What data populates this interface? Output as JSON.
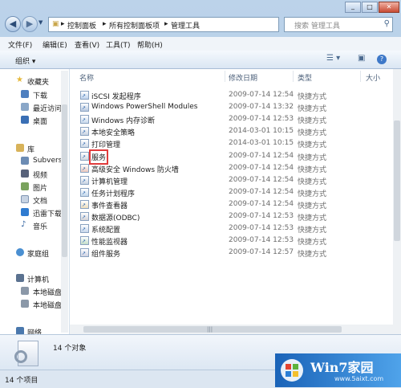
{
  "address": {
    "breadcrumbs": [
      "控制面板",
      "所有控制面板项",
      "管理工具"
    ],
    "search_placeholder": "搜索 管理工具"
  },
  "menubar": [
    "文件(F)",
    "编辑(E)",
    "查看(V)",
    "工具(T)",
    "帮助(H)"
  ],
  "toolbar": {
    "organize_label": "组织 ▾"
  },
  "nav": {
    "favorites": {
      "label": "收藏夹",
      "items": [
        "下载",
        "最近访问",
        "桌面"
      ]
    },
    "libraries": {
      "label": "库",
      "items": [
        "Subvers",
        "视频",
        "图片",
        "文档",
        "迅雷下载",
        "音乐"
      ]
    },
    "homegroup": "家庭组",
    "computer": {
      "label": "计算机",
      "items": [
        "本地磁盘",
        "本地磁盘"
      ]
    },
    "network": "网络"
  },
  "columns": {
    "name": "名称",
    "modified": "修改日期",
    "type": "类型",
    "size": "大小"
  },
  "files": [
    {
      "name": "iSCSI 发起程序",
      "date": "2009-07-14 12:54",
      "type": "快捷方式"
    },
    {
      "name": "Windows PowerShell Modules",
      "date": "2009-07-14 13:32",
      "type": "快捷方式"
    },
    {
      "name": "Windows 内存诊断",
      "date": "2009-07-14 12:53",
      "type": "快捷方式"
    },
    {
      "name": "本地安全策略",
      "date": "2014-03-01 10:15",
      "type": "快捷方式"
    },
    {
      "name": "打印管理",
      "date": "2014-03-01 10:15",
      "type": "快捷方式"
    },
    {
      "name": "服务",
      "date": "2009-07-14 12:54",
      "type": "快捷方式"
    },
    {
      "name": "高级安全 Windows 防火墙",
      "date": "2009-07-14 12:54",
      "type": "快捷方式"
    },
    {
      "name": "计算机管理",
      "date": "2009-07-14 12:54",
      "type": "快捷方式"
    },
    {
      "name": "任务计划程序",
      "date": "2009-07-14 12:54",
      "type": "快捷方式"
    },
    {
      "name": "事件查看器",
      "date": "2009-07-14 12:54",
      "type": "快捷方式"
    },
    {
      "name": "数据源(ODBC)",
      "date": "2009-07-14 12:53",
      "type": "快捷方式"
    },
    {
      "name": "系统配置",
      "date": "2009-07-14 12:53",
      "type": "快捷方式"
    },
    {
      "name": "性能监视器",
      "date": "2009-07-14 12:53",
      "type": "快捷方式"
    },
    {
      "name": "组件服务",
      "date": "2009-07-14 12:57",
      "type": "快捷方式"
    }
  ],
  "highlighted_file": "服务",
  "details": {
    "count_text": "14 个对象"
  },
  "status": {
    "text": "14 个项目"
  },
  "watermark": {
    "title": "Win7家园",
    "url": "www.5aixt.com"
  },
  "colors": {
    "highlight": "#e03b3b",
    "selection_blue": "#1a63b8"
  }
}
